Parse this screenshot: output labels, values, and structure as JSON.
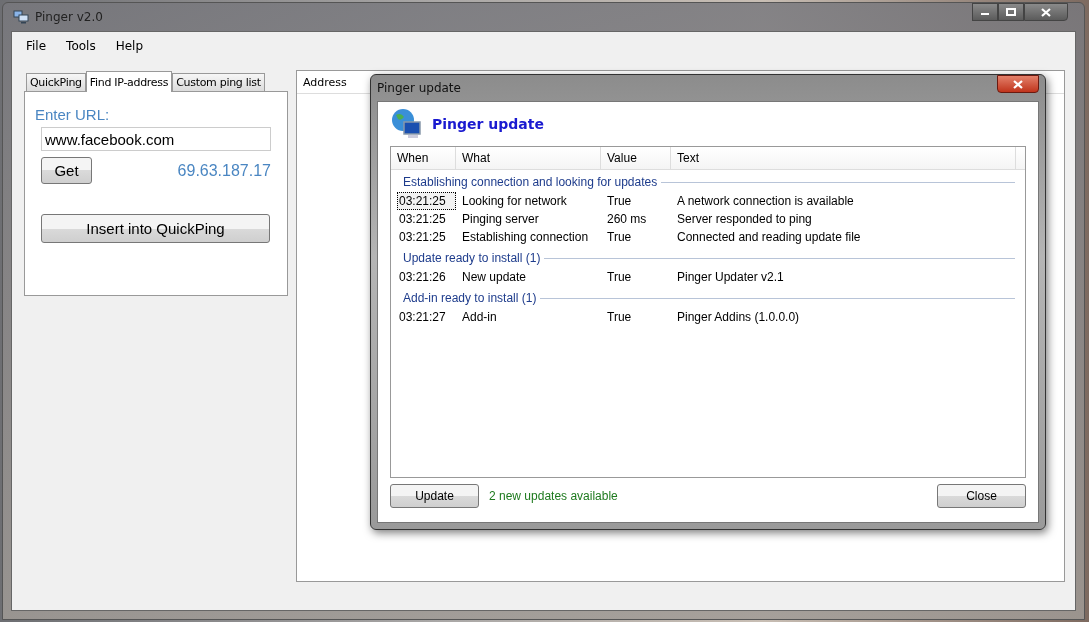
{
  "window": {
    "title": "Pinger v2.0"
  },
  "menu": [
    "File",
    "Tools",
    "Help"
  ],
  "tabs": [
    {
      "label": "QuickPing",
      "selected": false
    },
    {
      "label": "Find IP-address",
      "selected": true
    },
    {
      "label": "Custom ping list",
      "selected": false
    }
  ],
  "find_ip": {
    "label": "Enter URL:",
    "url_value": "www.facebook.com",
    "get_button": "Get",
    "result": "69.63.187.17",
    "insert_button": "Insert into QuickPing"
  },
  "address_list": {
    "columns": [
      "Address"
    ]
  },
  "dialog": {
    "title": "Pinger update",
    "heading": "Pinger update",
    "columns": [
      "When",
      "What",
      "Value",
      "Text"
    ],
    "groups": [
      {
        "title": "Establishing connection and looking for updates",
        "rows": [
          {
            "when": "03:21:25",
            "what": "Looking for network",
            "value": "True",
            "text": "A network connection is available",
            "selected": true
          },
          {
            "when": "03:21:25",
            "what": "Pinging server",
            "value": "260 ms",
            "text": "Server responded to ping",
            "selected": false
          },
          {
            "when": "03:21:25",
            "what": "Establishing connection",
            "value": "True",
            "text": "Connected and reading update file",
            "selected": false
          }
        ]
      },
      {
        "title": "Update ready to install (1)",
        "rows": [
          {
            "when": "03:21:26",
            "what": "New update",
            "value": "True",
            "text": "Pinger Updater v2.1",
            "selected": false
          }
        ]
      },
      {
        "title": "Add-in ready to install (1)",
        "rows": [
          {
            "when": "03:21:27",
            "what": "Add-in",
            "value": "True",
            "text": "Pinger Addins (1.0.0.0)",
            "selected": false
          }
        ]
      }
    ],
    "update_button": "Update",
    "status": "2 new updates available",
    "close_button": "Close"
  }
}
